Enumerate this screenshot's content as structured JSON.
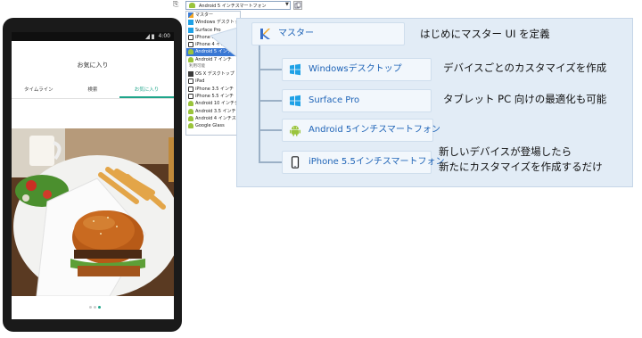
{
  "toolbar": {
    "selected_device": "Android 5 インチスマートフォン",
    "arrow": "▼"
  },
  "dropdown": {
    "top_items": [
      {
        "label": "マスター",
        "icon": "k"
      },
      {
        "label": "Windows デスクトップ",
        "icon": "w"
      },
      {
        "label": "Surface Pro",
        "icon": "w"
      },
      {
        "label": "iPhone 5.5 インチ",
        "icon": "p"
      },
      {
        "label": "iPhone 4 インチ",
        "icon": "p"
      },
      {
        "label": "Android 5 インチ",
        "icon": "a",
        "selected": true
      },
      {
        "label": "Android 7 インチ",
        "icon": "a"
      }
    ],
    "group_label": "利用可能",
    "more_items": [
      {
        "label": "OS X デスクトップ",
        "icon": "m"
      },
      {
        "label": "iPad",
        "icon": "p"
      },
      {
        "label": "iPhone 3.5 インチ",
        "icon": "p"
      },
      {
        "label": "iPhone 5.5 インチ",
        "icon": "p"
      },
      {
        "label": "Android 10 インチタブ",
        "icon": "a"
      },
      {
        "label": "Android 3.5 インチスマ",
        "icon": "a"
      },
      {
        "label": "Android 4 インチスマ",
        "icon": "a"
      },
      {
        "label": "Google Glass",
        "icon": "a"
      }
    ]
  },
  "callout": {
    "master": {
      "label": "マスター",
      "icon": "master-icon"
    },
    "nodes": [
      {
        "label": "Windowsデスクトップ",
        "icon": "windows-icon"
      },
      {
        "label": "Surface Pro",
        "icon": "windows-icon"
      },
      {
        "label": "Android 5インチスマートフォン",
        "icon": "android-icon"
      },
      {
        "label": "iPhone 5.5インチスマートフォン",
        "icon": "phone-icon"
      }
    ],
    "desc_master": "はじめにマスター UI を定義",
    "desc_windows": "デバイスごとのカスタマイズを作成",
    "desc_surface": "タブレット PC 向けの最適化も可能",
    "desc_new_line1": "新しいデバイスが登場したら",
    "desc_new_line2": "新たにカスタマイズを作成するだけ"
  },
  "phone": {
    "time": "4:00",
    "title": "お気に入り",
    "tabs": [
      "タイムライン",
      "検索",
      "お気に入り"
    ],
    "active_tab": 2,
    "pages": 3,
    "current_page": 2
  },
  "colors": {
    "accent": "#1ea58a",
    "link_blue": "#1f64b7",
    "panel_bg": "#e2ecf6",
    "windows_blue": "#1ea1e6",
    "android_green": "#9ac43c"
  }
}
